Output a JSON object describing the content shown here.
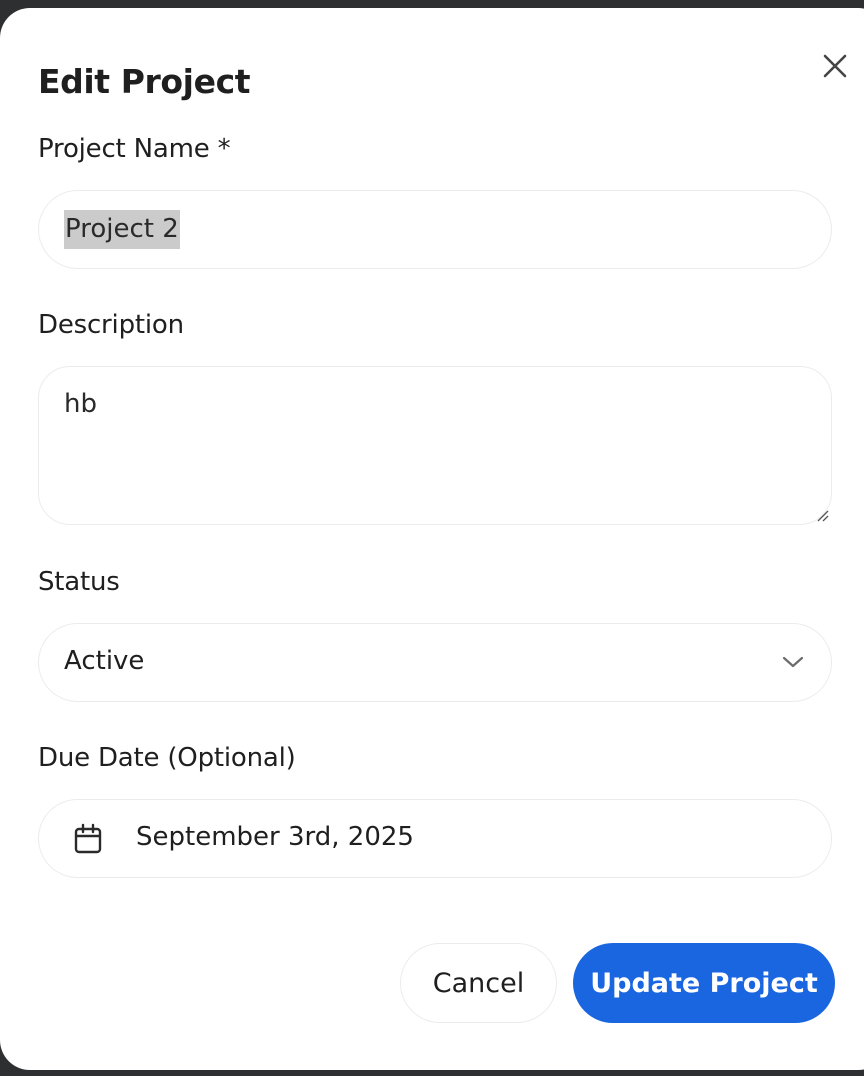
{
  "dialog": {
    "title": "Edit Project"
  },
  "form": {
    "project_name": {
      "label": "Project Name *",
      "value": "Project 2"
    },
    "description": {
      "label": "Description",
      "value": "hb"
    },
    "status": {
      "label": "Status",
      "selected": "Active"
    },
    "due_date": {
      "label": "Due Date (Optional)",
      "value": "September 3rd, 2025"
    }
  },
  "actions": {
    "cancel_label": "Cancel",
    "submit_label": "Update Project"
  },
  "icons": {
    "close": "close-icon",
    "chevron": "chevron-down-icon",
    "calendar": "calendar-icon",
    "resize": "resize-handle-icon"
  },
  "colors": {
    "primary": "#1a66e0",
    "backdrop": "#2e2f31",
    "selection_highlight": "#cbcbcb"
  }
}
